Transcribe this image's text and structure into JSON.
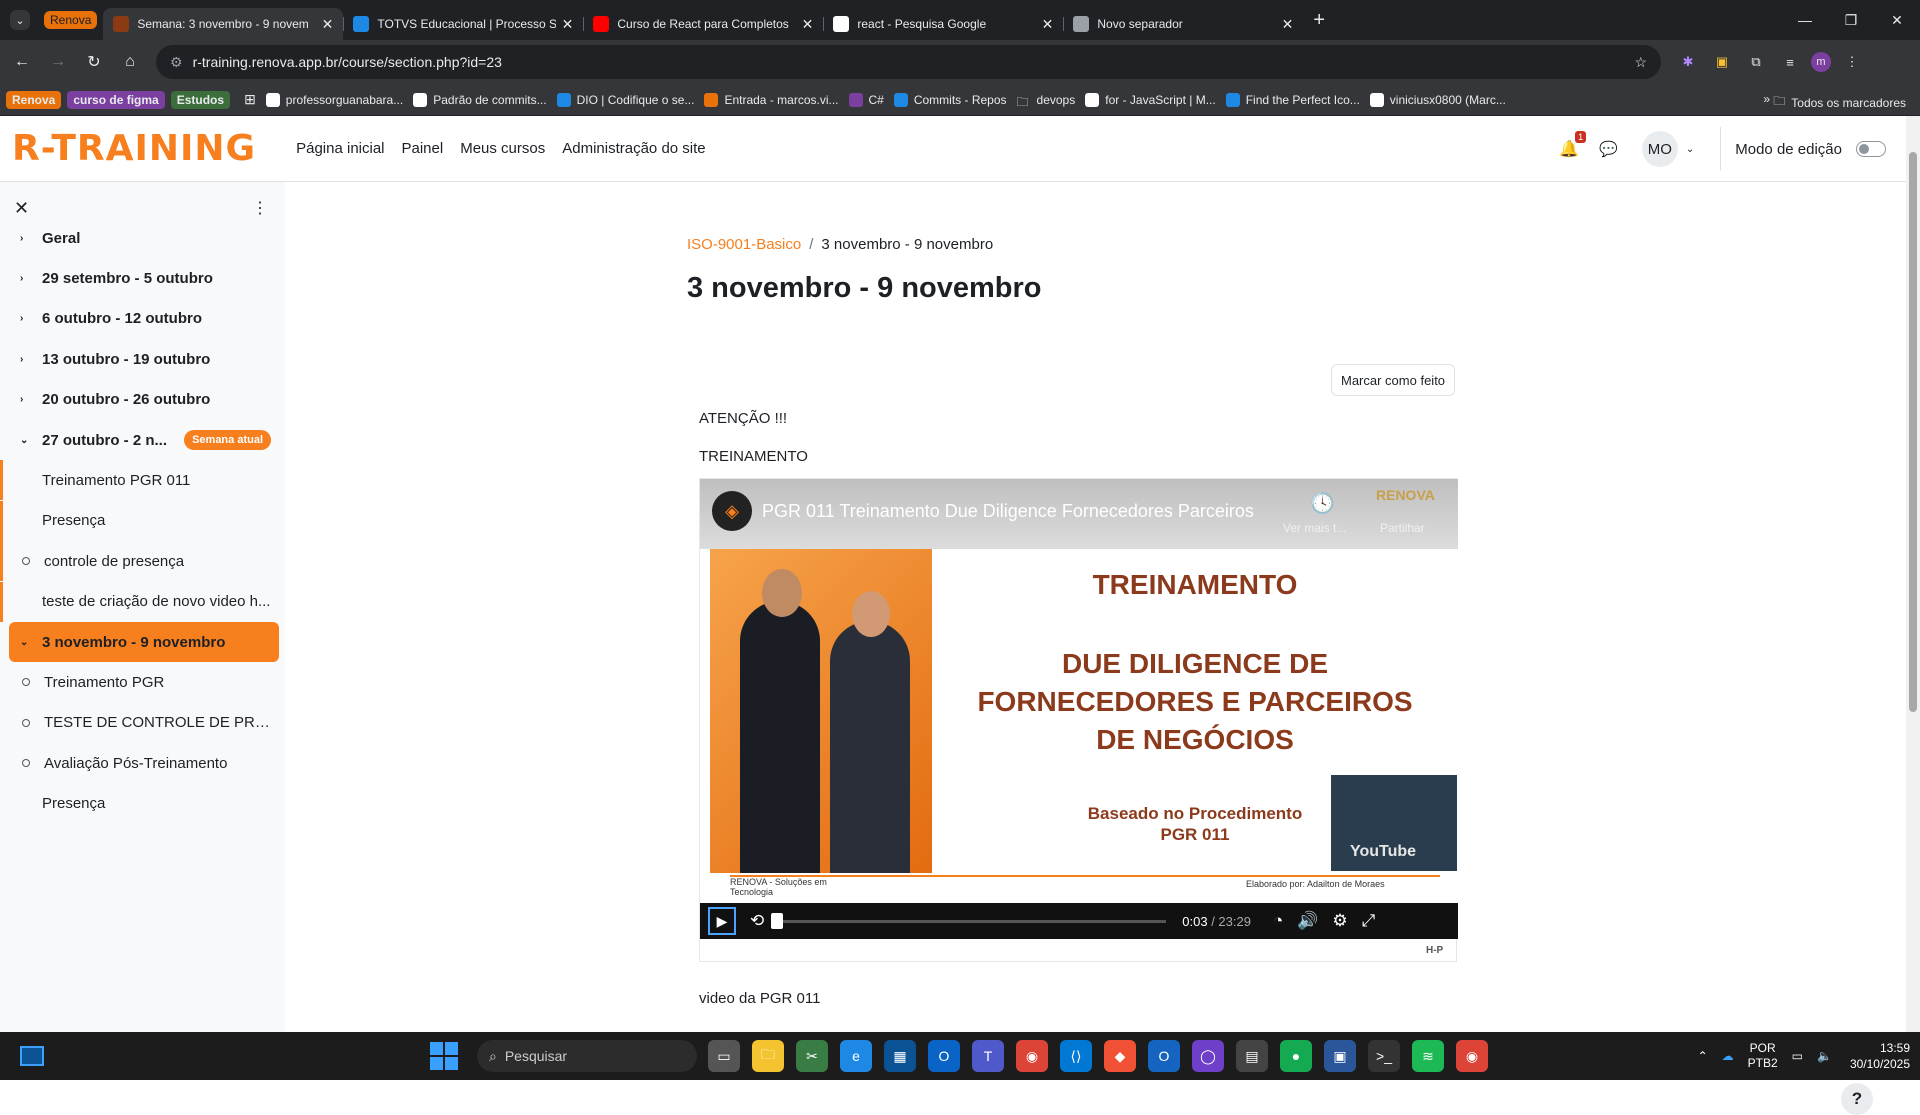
{
  "browser": {
    "tab_group": "Renova",
    "tabs": [
      {
        "title": "Semana: 3 novembro - 9 novem",
        "color": "#8b3a14"
      },
      {
        "title": "TOTVS Educacional | Processo S",
        "color": "#1e88e5"
      },
      {
        "title": "Curso de React para Completos",
        "color": "#ff0000"
      },
      {
        "title": "react - Pesquisa Google",
        "color": "#ffffff"
      },
      {
        "title": "Novo separador",
        "color": "#9aa0a6"
      }
    ],
    "url": "r-training.renova.app.br/course/section.php?id=23",
    "profile_initial": "m",
    "bookmarks": [
      {
        "label": "Renova",
        "type": "chip",
        "color": "#e8710a"
      },
      {
        "label": "curso de figma",
        "type": "chip",
        "color": "#7b3fa0"
      },
      {
        "label": "Estudos",
        "type": "chip",
        "color": "#3c6e3c"
      },
      {
        "label": "professorguanabara...",
        "type": "link",
        "color": "#ffffff"
      },
      {
        "label": "Padrão de commits...",
        "type": "link",
        "color": "#ffffff"
      },
      {
        "label": "DIO | Codifique o se...",
        "type": "link",
        "color": "#1e88e5"
      },
      {
        "label": "Entrada - marcos.vi...",
        "type": "link",
        "color": "#e8710a"
      },
      {
        "label": "C#",
        "type": "link",
        "color": "#7b3fa0"
      },
      {
        "label": "Commits - Repos",
        "type": "link",
        "color": "#1e88e5"
      },
      {
        "label": "devops",
        "type": "folder",
        "color": "#e8eaed"
      },
      {
        "label": "for - JavaScript | M...",
        "type": "link",
        "color": "#ffffff"
      },
      {
        "label": "Find the Perfect Ico...",
        "type": "link",
        "color": "#1e88e5"
      },
      {
        "label": "viniciusx0800 (Marc...",
        "type": "link",
        "color": "#ffffff"
      }
    ],
    "all_bookmarks": "Todos os marcadores"
  },
  "site": {
    "logo": "R-TRAINING",
    "brand_color": "#f77f1e",
    "nav": [
      "Página inicial",
      "Painel",
      "Meus cursos",
      "Administração do site"
    ],
    "notifications_count": "1",
    "user_initials": "MO",
    "edit_mode_label": "Modo de edição"
  },
  "sidebar": {
    "sections": [
      {
        "label": "Geral"
      },
      {
        "label": "29 setembro - 5 outubro"
      },
      {
        "label": "6 outubro - 12 outubro"
      },
      {
        "label": "13 outubro - 19 outubro"
      },
      {
        "label": "20 outubro - 26 outubro"
      },
      {
        "label": "27 outubro - 2 n...",
        "badge": "Semana atual"
      }
    ],
    "prev_activities": [
      {
        "label": "Treinamento PGR 011",
        "dot": false
      },
      {
        "label": "Presença",
        "dot": false
      },
      {
        "label": "controle de presença",
        "dot": true
      },
      {
        "label": "teste de criação de novo video h...",
        "dot": false
      }
    ],
    "current_section": "3 novembro - 9 novembro",
    "current_activities": [
      {
        "label": "Treinamento PGR",
        "dot": true
      },
      {
        "label": "TESTE DE CONTROLE DE PRESE...",
        "dot": true
      },
      {
        "label": "Avaliação Pós-Treinamento",
        "dot": true
      },
      {
        "label": "Presença",
        "dot": false
      }
    ]
  },
  "main": {
    "breadcrumb_course": "ISO-9001-Basico",
    "breadcrumb_current": "3 novembro - 9 novembro",
    "title": "3 novembro - 9 novembro",
    "mark_done": "Marcar como feito",
    "text1": "ATENÇÃO !!!",
    "text2": "TREINAMENTO",
    "caption": "video da PGR 011"
  },
  "video": {
    "title": "PGR 011 Treinamento Due Diligence Fornecedores Parceiros",
    "watch_later": "Ver mais t...",
    "share": "Partilhar",
    "brand": "RENOVA",
    "slide_heading": "TREINAMENTO",
    "slide_lines": [
      "DUE DILIGENCE DE",
      "FORNECEDORES E PARCEIROS",
      "DE NEGÓCIOS"
    ],
    "slide_based_1": "Baseado no Procedimento",
    "slide_based_2": "PGR 011",
    "footer_left": "RENOVA - Soluções em Tecnologia",
    "footer_right": "Elaborado por: Adailton de Moraes",
    "watermark": "YouTube",
    "current_time": "0:03",
    "duration": "/ 23:29",
    "progress": 0.002,
    "h5p": "H-P"
  },
  "taskbar": {
    "search": "Pesquisar",
    "lang1": "POR",
    "lang2": "PTB2",
    "time": "13:59",
    "date": "30/10/2025"
  }
}
